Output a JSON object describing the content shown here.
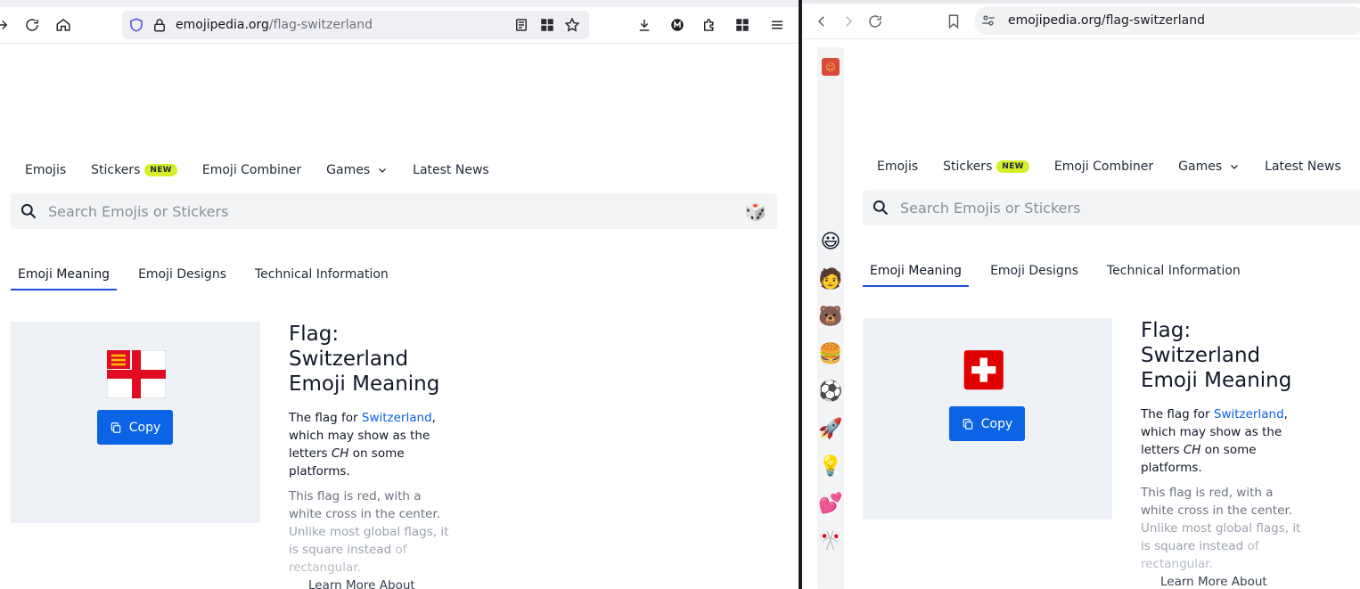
{
  "left_window": {
    "url_domain": "emojipedia.org",
    "url_path": "/flag-switzerland"
  },
  "right_window": {
    "url_domain": "emojipedia.org",
    "url_path": "/flag-switzerland"
  },
  "nav": {
    "emojis": "Emojis",
    "stickers": "Stickers",
    "stickers_badge": "NEW",
    "combiner": "Emoji Combiner",
    "games": "Games",
    "news": "Latest News"
  },
  "search": {
    "placeholder": "Search Emojis or Stickers"
  },
  "tabs": {
    "meaning": "Emoji Meaning",
    "designs": "Emoji Designs",
    "technical": "Technical Information"
  },
  "card": {
    "copy_label": "Copy"
  },
  "meaning": {
    "title_line1": "Flag:",
    "title_line2": "Switzerland",
    "title_line3": "Emoji Meaning",
    "p1_before": "The flag for ",
    "p1_link": "Switzerland",
    "p1_after_left": ", which may show as the letters ",
    "p1_letters": "CH",
    "p1_end": " on some platforms.",
    "p2_a": "This flag is red, with a white cross in the center.",
    "p2_b": "Unlike most global flags, it is square instead",
    "p2_c": "of rectangular.",
    "learn_more": "Learn More About"
  },
  "sidebar": {
    "emojis": [
      "😃",
      "🧑",
      "🐻",
      "🍔",
      "⚽",
      "🚀",
      "💡",
      "💕",
      "🎌"
    ]
  },
  "colors": {
    "accent": "#0b63e5",
    "badge": "#d6ee2a",
    "card_bg": "#eef1f6",
    "flag_red": "#ff0000"
  }
}
